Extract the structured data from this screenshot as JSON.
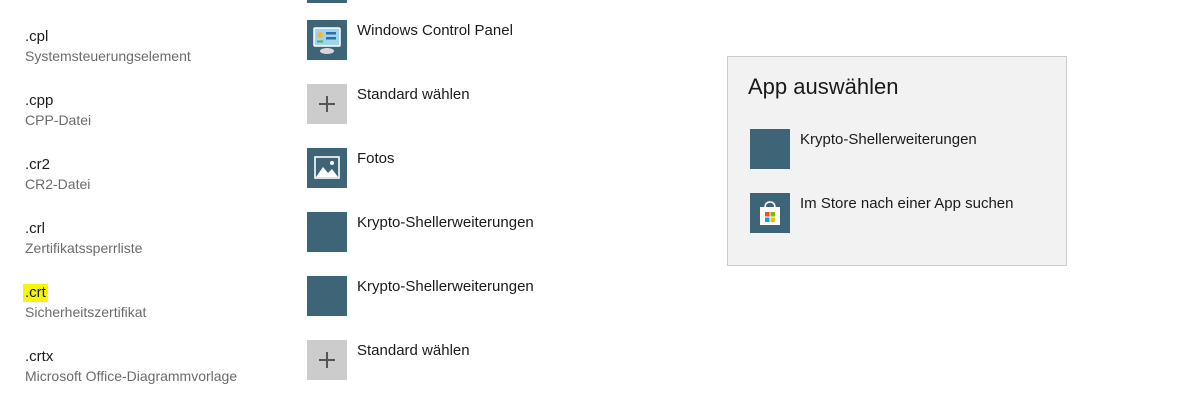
{
  "rows": [
    {
      "ext": ".cpl",
      "desc": "Systemsteuerungselement",
      "app": "Windows Control Panel",
      "icon": "control-panel-icon"
    },
    {
      "ext": ".cpp",
      "desc": "CPP-Datei",
      "app": "Standard wählen",
      "icon": "plus-icon"
    },
    {
      "ext": ".cr2",
      "desc": "CR2-Datei",
      "app": "Fotos",
      "icon": "photos-icon"
    },
    {
      "ext": ".crl",
      "desc": "Zertifikatssperrliste",
      "app": "Krypto-Shellerweiterungen",
      "icon": "crypto-shell-icon"
    },
    {
      "ext": ".crt",
      "desc": "Sicherheitszertifikat",
      "app": "Krypto-Shellerweiterungen",
      "icon": "crypto-shell-icon",
      "highlighted": true
    },
    {
      "ext": ".crtx",
      "desc": "Microsoft Office-Diagrammvorlage",
      "app": "Standard wählen",
      "icon": "plus-icon"
    }
  ],
  "flyout": {
    "title": "App auswählen",
    "items": [
      {
        "label": "Krypto-Shellerweiterungen",
        "icon": "crypto-shell-icon"
      },
      {
        "label": "Im Store nach einer App suchen",
        "icon": "store-icon"
      }
    ]
  },
  "colors": {
    "tile": "#3e6478",
    "highlight": "#f6f50c",
    "flyout_bg": "#f2f2f2"
  }
}
